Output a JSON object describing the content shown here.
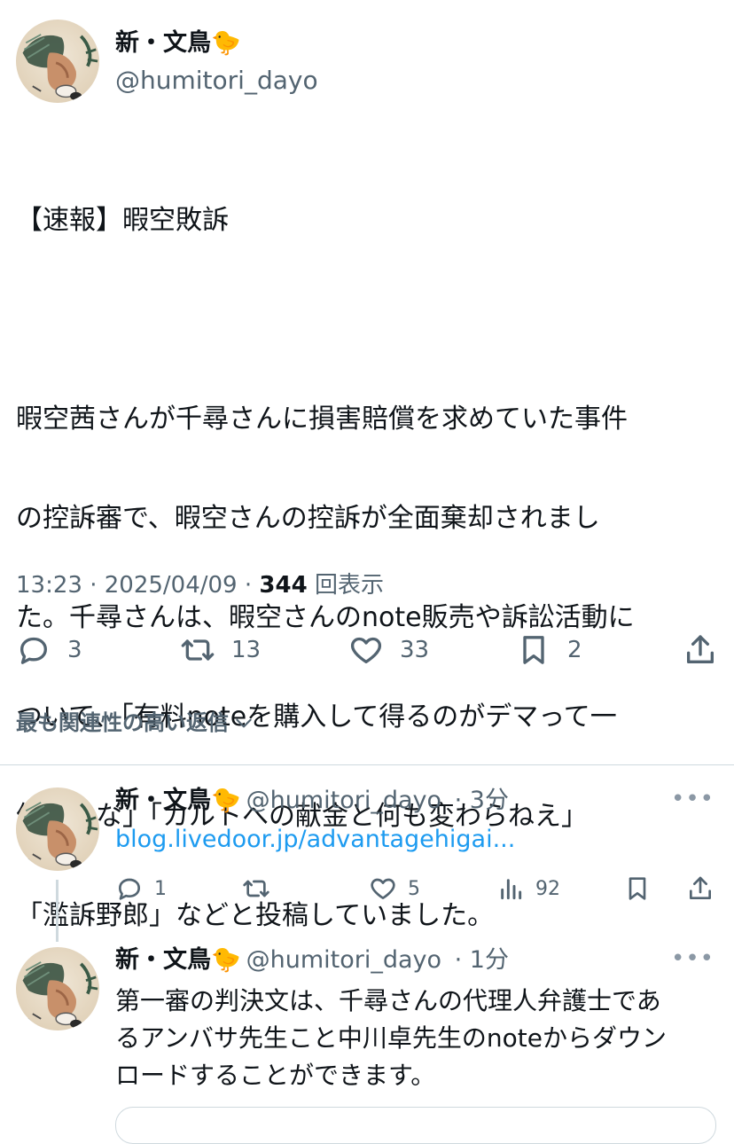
{
  "tweet": {
    "author_name": "新・文鳥🐤",
    "author_handle": "@humitori_dayo",
    "text_lines": [
      "【速報】暇空敗訴",
      "",
      "暇空茜さんが千尋さんに損害賠償を求めていた事件",
      "の控訴審で、暇空さんの控訴が全面棄却されまし",
      "た。千尋さんは、暇空さんのnote販売や訴訟活動に",
      "ついて、「有料noteを購入して得るのがデマって一",
      "体どんな」「カルトへの献金と何も変わらねえ」",
      "「濫訴野郎」などと投稿していました。"
    ],
    "time": "13:23",
    "date": "2025/04/09",
    "views": "344",
    "views_label": "回表示",
    "replies": "3",
    "retweets": "13",
    "likes": "33",
    "bookmarks": "2"
  },
  "replies_toggle": {
    "label": "最も関連性の高い返信"
  },
  "replies": [
    {
      "author_name": "新・文鳥🐤",
      "author_handle": "@humitori_dayo",
      "time_ago": "3分",
      "link_text": "blog.livedoor.jp/advantagehigai...",
      "replies": "1",
      "likes": "5",
      "views": "92"
    },
    {
      "author_name": "新・文鳥🐤",
      "author_handle": "@humitori_dayo",
      "time_ago": "1分",
      "text_lines": [
        "第一審の判決文は、千尋さんの代理人弁護士であ",
        "るアンバサ先生こと中川卓先生のnoteからダウン",
        "ロードすることができます。"
      ]
    }
  ],
  "icons": {
    "reply": "speech-bubble-icon",
    "retweet": "retweet-icon",
    "like": "heart-icon",
    "bookmark": "bookmark-icon",
    "share": "share-icon",
    "views": "bar-chart-icon",
    "more": "more-dots-icon",
    "expand": "chevron-down-icon"
  },
  "colors": {
    "text": "#0f1419",
    "secondary": "#536471",
    "link": "#1d9bf0",
    "divider": "#cfd9de"
  }
}
